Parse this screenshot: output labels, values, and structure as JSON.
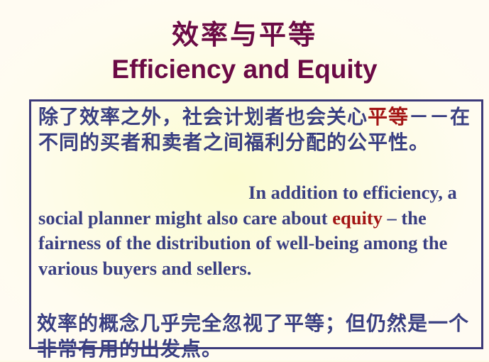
{
  "title": {
    "chinese": "效率与平等",
    "english": "Efficiency and Equity"
  },
  "box": {
    "cn_paragraph": {
      "before_highlight": "除了效率之外，社会计划者也会关心",
      "highlight": "平等",
      "after_highlight": "－－在不同的买者和卖者之间福利分配的公平性。"
    },
    "en_paragraph": {
      "before_highlight": "In addition to efficiency, a social planner might also care about ",
      "highlight": "equity",
      "after_highlight": " – the fairness of the distribution of well-being among the various buyers and sellers."
    }
  },
  "footer_cn": "效率的概念几乎完全忽视了平等；但仍然是一个非常有用的出发点。",
  "colors": {
    "title": "#6b0a45",
    "body_text": "#3a3f82",
    "highlight": "#a31515",
    "box_border": "#3c3a7a"
  }
}
